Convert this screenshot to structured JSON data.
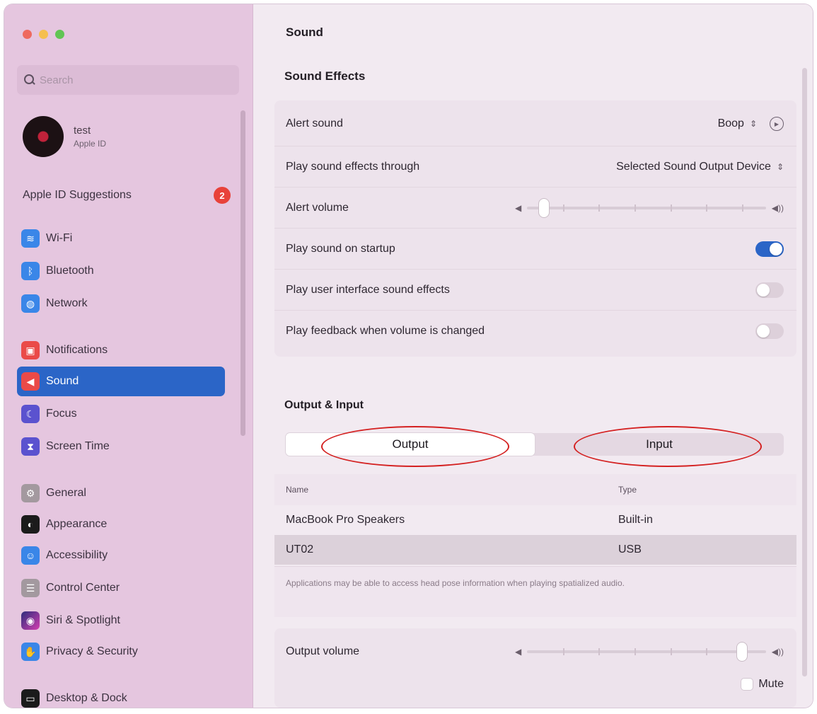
{
  "sidebar": {
    "search_placeholder": "Search",
    "profile": {
      "name": "test",
      "subtitle": "Apple ID"
    },
    "suggestions": {
      "label": "Apple ID Suggestions",
      "badge": "2"
    },
    "items": [
      {
        "label": "Wi-Fi",
        "icon": "wifi-icon"
      },
      {
        "label": "Bluetooth",
        "icon": "bluetooth-icon"
      },
      {
        "label": "Network",
        "icon": "network-icon"
      },
      {
        "label": "Notifications",
        "icon": "notifications-icon"
      },
      {
        "label": "Sound",
        "icon": "sound-icon",
        "active": true
      },
      {
        "label": "Focus",
        "icon": "focus-icon"
      },
      {
        "label": "Screen Time",
        "icon": "screen-time-icon"
      },
      {
        "label": "General",
        "icon": "general-icon"
      },
      {
        "label": "Appearance",
        "icon": "appearance-icon"
      },
      {
        "label": "Accessibility",
        "icon": "accessibility-icon"
      },
      {
        "label": "Control Center",
        "icon": "control-center-icon"
      },
      {
        "label": "Siri & Spotlight",
        "icon": "siri-icon"
      },
      {
        "label": "Privacy & Security",
        "icon": "privacy-icon"
      },
      {
        "label": "Desktop & Dock",
        "icon": "dock-icon"
      }
    ]
  },
  "main": {
    "title": "Sound",
    "sound_effects": {
      "title": "Sound Effects",
      "alert_sound": {
        "label": "Alert sound",
        "value": "Boop"
      },
      "play_through": {
        "label": "Play sound effects through",
        "value": "Selected Sound Output Device"
      },
      "alert_volume": {
        "label": "Alert volume",
        "level": 0.07
      },
      "startup": {
        "label": "Play sound on startup",
        "on": true
      },
      "ui_sounds": {
        "label": "Play user interface sound effects",
        "on": false
      },
      "feedback": {
        "label": "Play feedback when volume is changed",
        "on": false
      }
    },
    "output_input": {
      "title": "Output & Input",
      "tabs": [
        {
          "label": "Output",
          "active": true
        },
        {
          "label": "Input",
          "active": false
        }
      ],
      "columns": {
        "name": "Name",
        "type": "Type"
      },
      "devices": [
        {
          "name": "MacBook Pro Speakers",
          "type": "Built-in",
          "selected": false
        },
        {
          "name": "UT02",
          "type": "USB",
          "selected": true
        }
      ],
      "note": "Applications may be able to access head pose information when playing spatialized audio."
    },
    "output_volume": {
      "label": "Output volume",
      "level": 0.9,
      "mute_label": "Mute",
      "muted": false
    }
  },
  "colors": {
    "accent": "#2b65c7",
    "annotation": "#d42121",
    "badge": "#e8423a"
  }
}
